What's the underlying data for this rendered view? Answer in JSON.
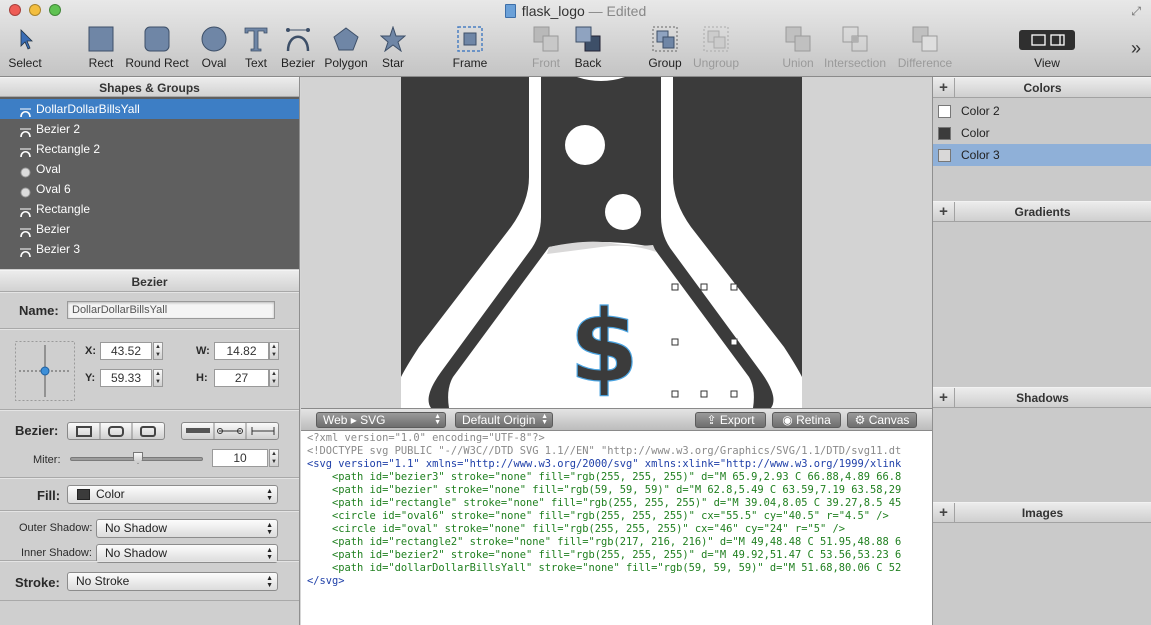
{
  "window": {
    "title": "flask_logo",
    "status": "— Edited"
  },
  "toolbar": {
    "items": [
      {
        "label": "Select",
        "icon": "cursor-icon"
      },
      {
        "label": "Rect",
        "icon": "rect-icon"
      },
      {
        "label": "Round Rect",
        "icon": "round-rect-icon"
      },
      {
        "label": "Oval",
        "icon": "oval-icon"
      },
      {
        "label": "Text",
        "icon": "text-icon"
      },
      {
        "label": "Bezier",
        "icon": "bezier-icon"
      },
      {
        "label": "Polygon",
        "icon": "polygon-icon"
      },
      {
        "label": "Star",
        "icon": "star-icon"
      },
      {
        "label": "Frame",
        "icon": "frame-icon"
      },
      {
        "label": "Front",
        "icon": "front-icon"
      },
      {
        "label": "Back",
        "icon": "back-icon"
      },
      {
        "label": "Group",
        "icon": "group-icon"
      },
      {
        "label": "Ungroup",
        "icon": "ungroup-icon"
      },
      {
        "label": "Union",
        "icon": "union-icon"
      },
      {
        "label": "Intersection",
        "icon": "intersection-icon"
      },
      {
        "label": "Difference",
        "icon": "difference-icon"
      },
      {
        "label": "View",
        "icon": "view-icon"
      }
    ],
    "overflow": "»"
  },
  "left": {
    "shapes_header": "Shapes & Groups",
    "layers": [
      {
        "name": "DollarDollarBillsYall",
        "kind": "bezier",
        "selected": true
      },
      {
        "name": "Bezier 2",
        "kind": "bezier"
      },
      {
        "name": "Rectangle 2",
        "kind": "bezier"
      },
      {
        "name": "Oval",
        "kind": "oval"
      },
      {
        "name": "Oval 6",
        "kind": "oval"
      },
      {
        "name": "Rectangle",
        "kind": "bezier"
      },
      {
        "name": "Bezier",
        "kind": "bezier"
      },
      {
        "name": "Bezier 3",
        "kind": "bezier"
      }
    ],
    "inspector_header": "Bezier",
    "name_label": "Name:",
    "name_value": "DollarDollarBillsYall",
    "x_label": "X:",
    "x_value": "43.52",
    "y_label": "Y:",
    "y_value": "59.33",
    "w_label": "W:",
    "w_value": "14.82",
    "h_label": "H:",
    "h_value": "27",
    "bezier_label": "Bezier:",
    "miter_label": "Miter:",
    "miter_value": "10",
    "miter_level": 0.5,
    "fill_label": "Fill:",
    "fill_value": "Color",
    "outer_shadow_label": "Outer Shadow:",
    "outer_shadow_value": "No Shadow",
    "inner_shadow_label": "Inner Shadow:",
    "inner_shadow_value": "No Shadow",
    "stroke_label": "Stroke:",
    "stroke_value": "No Stroke"
  },
  "codebar": {
    "format": "Web ▸ SVG",
    "origin": "Default Origin",
    "export": "Export",
    "retina": "Retina",
    "canvas": "Canvas"
  },
  "code_lines": [
    "<?xml version=\"1.0\" encoding=\"UTF-8\"?>",
    "<!DOCTYPE svg PUBLIC \"-//W3C//DTD SVG 1.1//EN\" \"http://www.w3.org/Graphics/SVG/1.1/DTD/svg11.dt",
    "<svg version=\"1.1\" xmlns=\"http://www.w3.org/2000/svg\" xmlns:xlink=\"http://www.w3.org/1999/xlink",
    "    <path id=\"bezier3\" stroke=\"none\" fill=\"rgb(255, 255, 255)\" d=\"M 65.9,2.93 C 66.88,4.89 66.8",
    "    <path id=\"bezier\" stroke=\"none\" fill=\"rgb(59, 59, 59)\" d=\"M 62.8,5.49 C 63.59,7.19 63.58,29",
    "    <path id=\"rectangle\" stroke=\"none\" fill=\"rgb(255, 255, 255)\" d=\"M 39.04,8.05 C 39.27,8.5 45",
    "    <circle id=\"oval6\" stroke=\"none\" fill=\"rgb(255, 255, 255)\" cx=\"55.5\" cy=\"40.5\" r=\"4.5\" />",
    "    <circle id=\"oval\" stroke=\"none\" fill=\"rgb(255, 255, 255)\" cx=\"46\" cy=\"24\" r=\"5\" />",
    "    <path id=\"rectangle2\" stroke=\"none\" fill=\"rgb(217, 216, 216)\" d=\"M 49,48.48 C 51.95,48.88 6",
    "    <path id=\"bezier2\" stroke=\"none\" fill=\"rgb(255, 255, 255)\" d=\"M 49.92,51.47 C 53.56,53.23 6",
    "    <path id=\"dollarDollarBillsYall\" stroke=\"none\" fill=\"rgb(59, 59, 59)\" d=\"M 51.68,80.06 C 52",
    "</svg>"
  ],
  "right": {
    "colors_header": "Colors",
    "colors": [
      {
        "name": "Color 2",
        "swatch": "#ffffff"
      },
      {
        "name": "Color",
        "swatch": "#3b3b3b"
      },
      {
        "name": "Color 3",
        "swatch": "#d9d8d8",
        "selected": true
      }
    ],
    "gradients_header": "Gradients",
    "shadows_header": "Shadows",
    "images_header": "Images",
    "add": "+"
  },
  "colors": {
    "selection": "#3d7ec5",
    "dark": "#3b3b3b",
    "light_gray": "#d9d8d8"
  }
}
